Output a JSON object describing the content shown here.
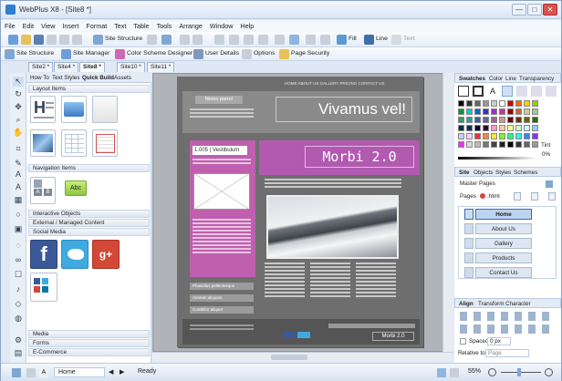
{
  "window": {
    "title": "WebPlus X8 - [Site8 *]",
    "minimize": "—",
    "maximize": "□",
    "close": "✕"
  },
  "menu": [
    "File",
    "Edit",
    "View",
    "Insert",
    "Format",
    "Text",
    "Table",
    "Tools",
    "Arrange",
    "Window",
    "Help"
  ],
  "toolbar1": {
    "site_structure": "Site Structure",
    "fill": "Fill",
    "line": "Line",
    "text": "Text"
  },
  "toolbar2": {
    "site_structure": "Site Structure",
    "site_manager": "Site Manager",
    "color_scheme": "Color Scheme Designer",
    "user_details": "User Details",
    "options": "Options",
    "page_security": "Page Security"
  },
  "page_tabs": [
    "Site2 *",
    "Site4 *",
    "Site8 *",
    "Site10 *",
    "Site11 *"
  ],
  "left_panel": {
    "tabs": [
      "How To",
      "Text Styles",
      "Quick Build",
      "Assets"
    ],
    "sections": {
      "layout": "Layout Items",
      "navigation": "Navigation Items",
      "interactive": "Interactive Objects",
      "external": "External / Managed Content",
      "social": "Social Media",
      "media": "Media",
      "forms": "Forms",
      "ecommerce": "E-Commerce"
    },
    "abc": "Abc"
  },
  "canvas": {
    "nav": "HOME  ABOUT US  GALLERY  PRICING  CONTACT US",
    "header_title": "Vivamus vel!",
    "tag": "Nemo porro!",
    "col_title": "Vestibulum",
    "col_num": "1.005",
    "main_title": "Morbi 2.0",
    "footer_btn": "Morbi 2.0",
    "side_buttons": [
      "Phasellus pellentesque",
      "Aenean aliquam",
      "Curabitur aliquet"
    ]
  },
  "right_panel": {
    "top_tabs": [
      "Swatches",
      "Color",
      "Line",
      "Transparency"
    ],
    "tint": "Tint",
    "tint_value": "0%",
    "site_tabs": [
      "Site",
      "Objects",
      "Styles",
      "Schemes"
    ],
    "master_pages": "Master Pages",
    "pages_label": "Pages",
    "pages_file": ".html",
    "pages": [
      "Home",
      "About Us",
      "Gallery",
      "Products",
      "Contact Us"
    ],
    "align_tabs": [
      "Align",
      "Transform",
      "Character"
    ],
    "spaced": "Spaced",
    "spaced_value": "0 px",
    "relative_to": "Relative to:",
    "relative_value": "Page"
  },
  "status": {
    "page": "Home",
    "state": "Ready",
    "zoom": "55%"
  },
  "colors": {
    "accent": "#b25ab0",
    "page_dark": "#6e6e6e",
    "chrome": "#dfe9f5"
  }
}
